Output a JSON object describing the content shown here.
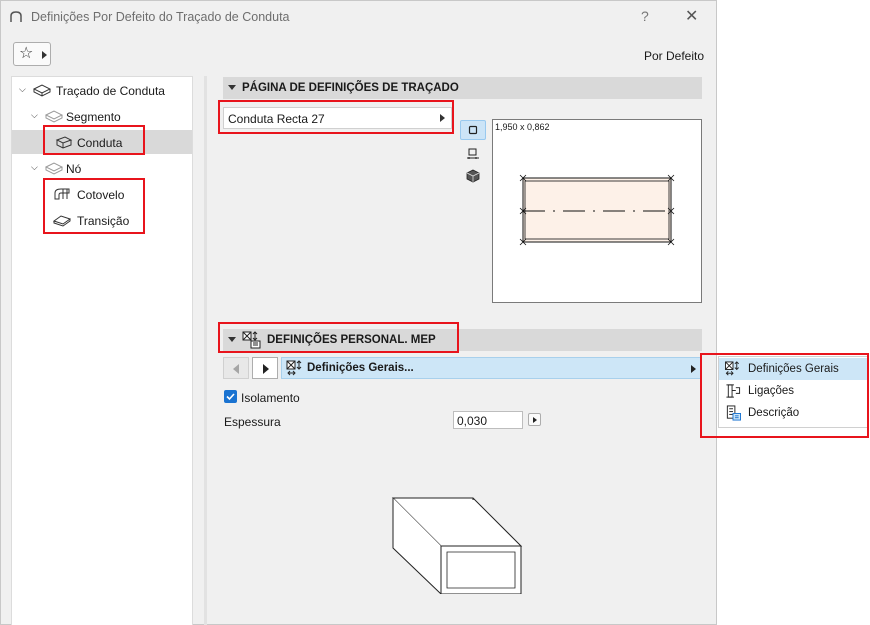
{
  "window": {
    "title": "Definições Por Defeito do Traçado de Conduta",
    "help_label": "?",
    "close_label": "✕"
  },
  "toolbar": {
    "favorites_icon": "star-icon",
    "default_label": "Por Defeito"
  },
  "tree": {
    "items": [
      {
        "label": "Traçado de Conduta",
        "level": 0,
        "expanded": true,
        "icon": "duct-route-icon"
      },
      {
        "label": "Segmento",
        "level": 1,
        "expanded": true,
        "icon": "segment-icon"
      },
      {
        "label": "Conduta",
        "level": 2,
        "selected": true,
        "icon": "duct-icon"
      },
      {
        "label": "Nó",
        "level": 1,
        "expanded": true,
        "icon": "node-icon"
      },
      {
        "label": "Cotovelo",
        "level": 2,
        "icon": "elbow-icon"
      },
      {
        "label": "Transição",
        "level": 2,
        "icon": "transition-icon"
      }
    ]
  },
  "route_settings": {
    "header": "PÁGINA DE DEFINIÇÕES DE TRAÇADO",
    "profile_value": "Conduta Recta 27",
    "preview_dims": "1,950 x 0,862",
    "view_buttons": [
      "plan-view-icon",
      "section-view-icon",
      "3d-view-icon"
    ]
  },
  "mep_settings": {
    "header": "DEFINIÇÕES PERSONAL. MEP",
    "current_page": "Definições Gerais...",
    "insulation_label": "Isolamento",
    "insulation_checked": true,
    "thickness_label": "Espessura",
    "thickness_value": "0,030"
  },
  "page_menu": {
    "items": [
      {
        "label": "Definições Gerais",
        "icon": "general-settings-icon",
        "selected": true
      },
      {
        "label": "Ligações",
        "icon": "connections-icon"
      },
      {
        "label": "Descrição",
        "icon": "description-icon"
      }
    ]
  },
  "colors": {
    "accent": "#1a73d1",
    "selection": "#cde6f7",
    "highlight_red": "#e8141c",
    "preview_fill": "#fdf1e8"
  }
}
